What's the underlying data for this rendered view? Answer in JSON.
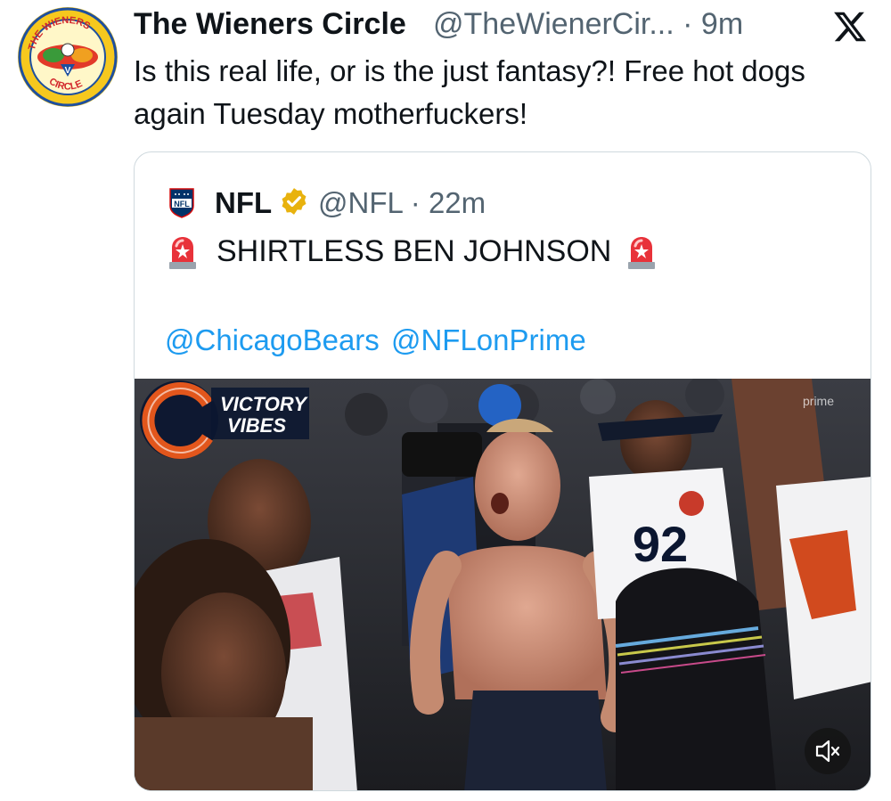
{
  "tweet": {
    "author_name": "The Wieners Circle",
    "author_handle": "@TheWienerCir...",
    "time_sep": " · ",
    "time": "9m",
    "text": "Is this real life, or is the just fantasy?! Free hot dogs again Tuesday motherfuckers!",
    "avatar_text_top": "THE WIENERS",
    "avatar_text_bottom": "CIRCLE"
  },
  "quote": {
    "author_name": "NFL",
    "author_handle": "@NFL",
    "time_sep": " · ",
    "time": "22m",
    "text": "SHIRTLESS BEN JOHNSON",
    "mentions": [
      "@ChicagoBears",
      "@NFLonPrime"
    ],
    "video": {
      "overlay_line1": "VICTORY",
      "overlay_line2": "VIBES",
      "watermark": "prime",
      "jersey_number": "92"
    }
  },
  "icons": {
    "close": "x-logo-icon",
    "verified": "verified-badge-icon",
    "siren": "siren-emoji-icon",
    "mute": "muted-speaker-icon"
  },
  "colors": {
    "link": "#1d9bf0",
    "secondary_text": "#536471",
    "verified_gold": "#e8b20e",
    "border": "#cfd9de"
  }
}
